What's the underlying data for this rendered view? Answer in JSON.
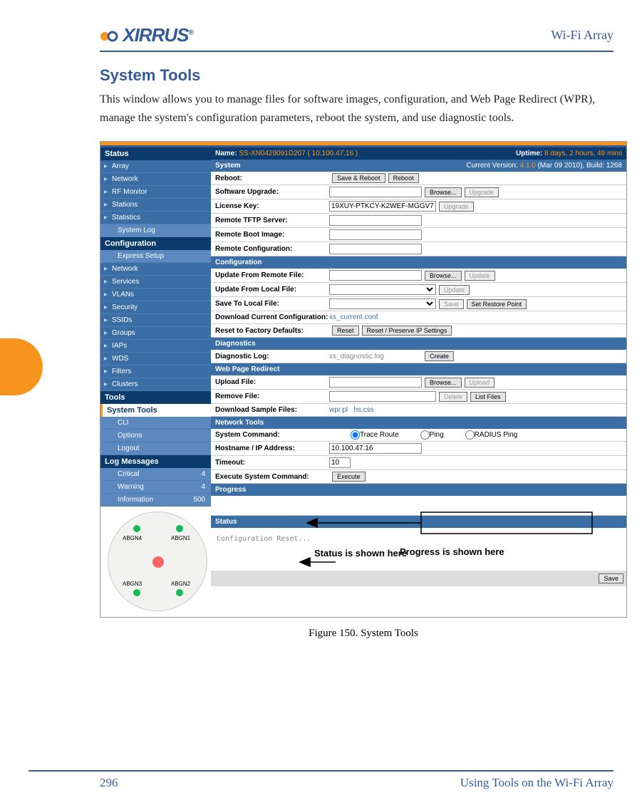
{
  "header": {
    "logo_text": "XIRRUS",
    "right_title": "Wi-Fi Array"
  },
  "section_title": "System Tools",
  "intro_text": "This window allows you to manage files for software images, configuration, and Web Page Redirect (WPR), manage the system's configuration parameters, reboot the system, and use diagnostic tools.",
  "sidebar": {
    "groups": [
      {
        "header": "Status",
        "items": [
          "Array",
          "Network",
          "RF Monitor",
          "Stations",
          "Statistics",
          "System Log"
        ]
      },
      {
        "header": "Configuration",
        "items": [
          "Express Setup",
          "Network",
          "Services",
          "VLANs",
          "Security",
          "SSIDs",
          "Groups",
          "IAPs",
          "WDS",
          "Filters",
          "Clusters"
        ]
      },
      {
        "header": "Tools",
        "items": [
          "System Tools",
          "CLI",
          "Options",
          "Logout"
        ]
      },
      {
        "header": "Log Messages",
        "rows": [
          {
            "k": "Critical",
            "v": "4"
          },
          {
            "k": "Warning",
            "v": "4"
          },
          {
            "k": "Information",
            "v": "500"
          }
        ]
      }
    ]
  },
  "topbar": {
    "name_label": "Name:",
    "name_value": "SS-XN0429091D207   ( 10.100.47.16 )",
    "uptime_label": "Uptime:",
    "uptime_value": "8 days, 2 hours, 49 mins",
    "ver_label": "Current Version:",
    "ver_value": "4.1.0",
    "ver_suffix": "(Mar 09 2010), Build: 1268"
  },
  "system": {
    "title": "System",
    "rows": {
      "reboot_label": "Reboot:",
      "btn_save_reboot": "Save & Reboot",
      "btn_reboot": "Reboot",
      "swup_label": "Software Upgrade:",
      "btn_browse": "Browse...",
      "btn_upgrade": "Upgrade",
      "lic_label": "License Key:",
      "lic_value": "19XUY-PTKCY-K2WEF-MGGV7",
      "tftp_label": "Remote TFTP Server:",
      "boot_label": "Remote Boot Image:",
      "rconf_label": "Remote Configuration:"
    }
  },
  "config": {
    "title": "Configuration",
    "remote_label": "Update From Remote File:",
    "local_label": "Update From Local File:",
    "save_label": "Save To Local File:",
    "btn_update": "Update",
    "btn_save": "Save",
    "btn_restore": "Set Restore Point",
    "dl_label": "Download Current Configuration:",
    "dl_value": "xs_current.conf",
    "reset_label": "Reset to Factory Defaults:",
    "btn_reset": "Reset",
    "btn_reset_preserve": "Reset / Preserve IP Settings"
  },
  "diag": {
    "title": "Diagnostics",
    "log_label": "Diagnostic Log:",
    "log_value": "xs_diagnostic.log",
    "btn_create": "Create"
  },
  "wpr": {
    "title": "Web Page Redirect",
    "upload_label": "Upload File:",
    "btn_upload": "Upload",
    "remove_label": "Remove File:",
    "btn_delete": "Delete",
    "btn_list": "List Files",
    "dl_label": "Download Sample Files:",
    "dl_v1": "wpr.pl",
    "dl_v2": "hs.css"
  },
  "nettools": {
    "title": "Network Tools",
    "cmd_label": "System Command:",
    "opt_trace": "Trace Route",
    "opt_ping": "Ping",
    "opt_radius": "RADIUS Ping",
    "host_label": "Hostname / IP Address:",
    "host_value": "10.100.47.16",
    "timeout_label": "Timeout:",
    "timeout_value": "10",
    "exec_label": "Execute System Command:",
    "btn_execute": "Execute"
  },
  "progress": {
    "title": "Progress"
  },
  "status": {
    "title": "Status",
    "text": "Configuration Reset..."
  },
  "annotations": {
    "a1": "Progress is shown here",
    "a2": "Status is shown here"
  },
  "diagram": {
    "labels": [
      "ABGN4",
      "ABGN1",
      "ABGN3",
      "ABGN2"
    ]
  },
  "caption": "Figure 150. System Tools",
  "save_btn": "Save",
  "footer": {
    "page": "296",
    "right": "Using Tools on the Wi-Fi Array"
  }
}
